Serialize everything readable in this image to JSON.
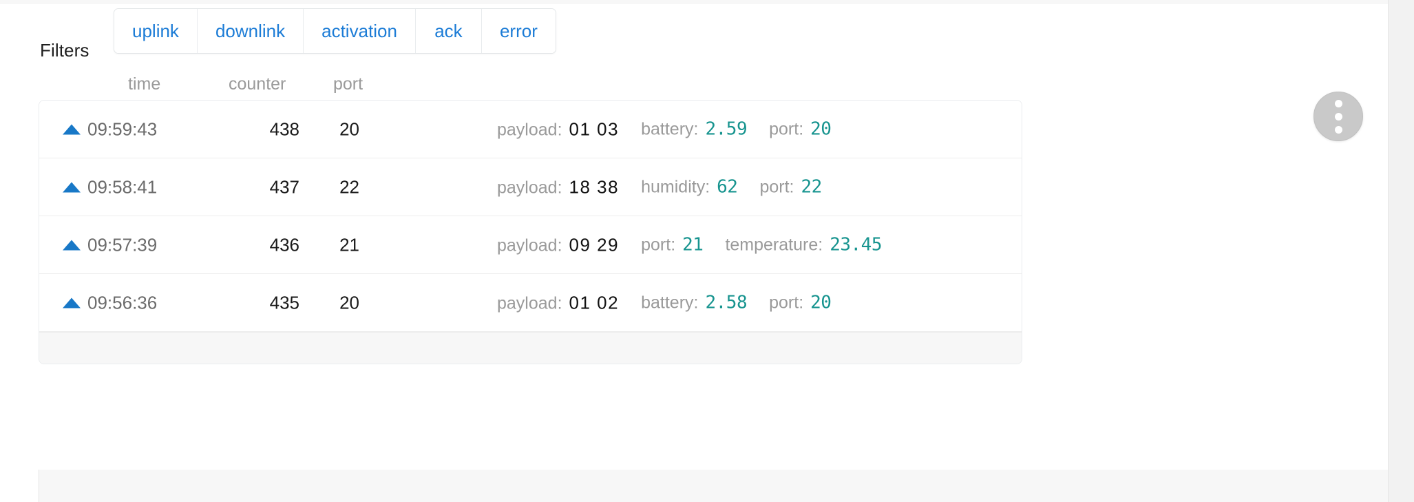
{
  "filters": {
    "label": "Filters",
    "buttons": [
      {
        "label": "uplink"
      },
      {
        "label": "downlink"
      },
      {
        "label": "activation"
      },
      {
        "label": "ack"
      },
      {
        "label": "error"
      }
    ],
    "accent_color": "#1c7cd6"
  },
  "table": {
    "columns": {
      "time": "time",
      "counter": "counter",
      "port": "port"
    },
    "rows": [
      {
        "direction_icon": "uplink-arrow-icon",
        "time": "09:59:43",
        "counter": "438",
        "port": "20",
        "fields": [
          {
            "key": "payload:",
            "value": "01 03",
            "type": "hex"
          },
          {
            "key": "battery:",
            "value": "2.59",
            "type": "num"
          },
          {
            "key": "port:",
            "value": "20",
            "type": "num"
          }
        ]
      },
      {
        "direction_icon": "uplink-arrow-icon",
        "time": "09:58:41",
        "counter": "437",
        "port": "22",
        "fields": [
          {
            "key": "payload:",
            "value": "18 38",
            "type": "hex"
          },
          {
            "key": "humidity:",
            "value": "62",
            "type": "num"
          },
          {
            "key": "port:",
            "value": "22",
            "type": "num"
          }
        ]
      },
      {
        "direction_icon": "uplink-arrow-icon",
        "time": "09:57:39",
        "counter": "436",
        "port": "21",
        "fields": [
          {
            "key": "payload:",
            "value": "09 29",
            "type": "hex"
          },
          {
            "key": "port:",
            "value": "21",
            "type": "num"
          },
          {
            "key": "temperature:",
            "value": "23.45",
            "type": "num"
          }
        ]
      },
      {
        "direction_icon": "uplink-arrow-icon",
        "time": "09:56:36",
        "counter": "435",
        "port": "20",
        "fields": [
          {
            "key": "payload:",
            "value": "01 02",
            "type": "hex"
          },
          {
            "key": "battery:",
            "value": "2.58",
            "type": "num"
          },
          {
            "key": "port:",
            "value": "20",
            "type": "num"
          }
        ]
      }
    ]
  },
  "fab": {
    "icon": "kebab-menu-icon",
    "dots": 3
  },
  "colors": {
    "accent_blue": "#1c7cd6",
    "value_teal": "#17948f",
    "arrow_blue": "#1878c7",
    "muted_grey": "#9a9a9a"
  }
}
